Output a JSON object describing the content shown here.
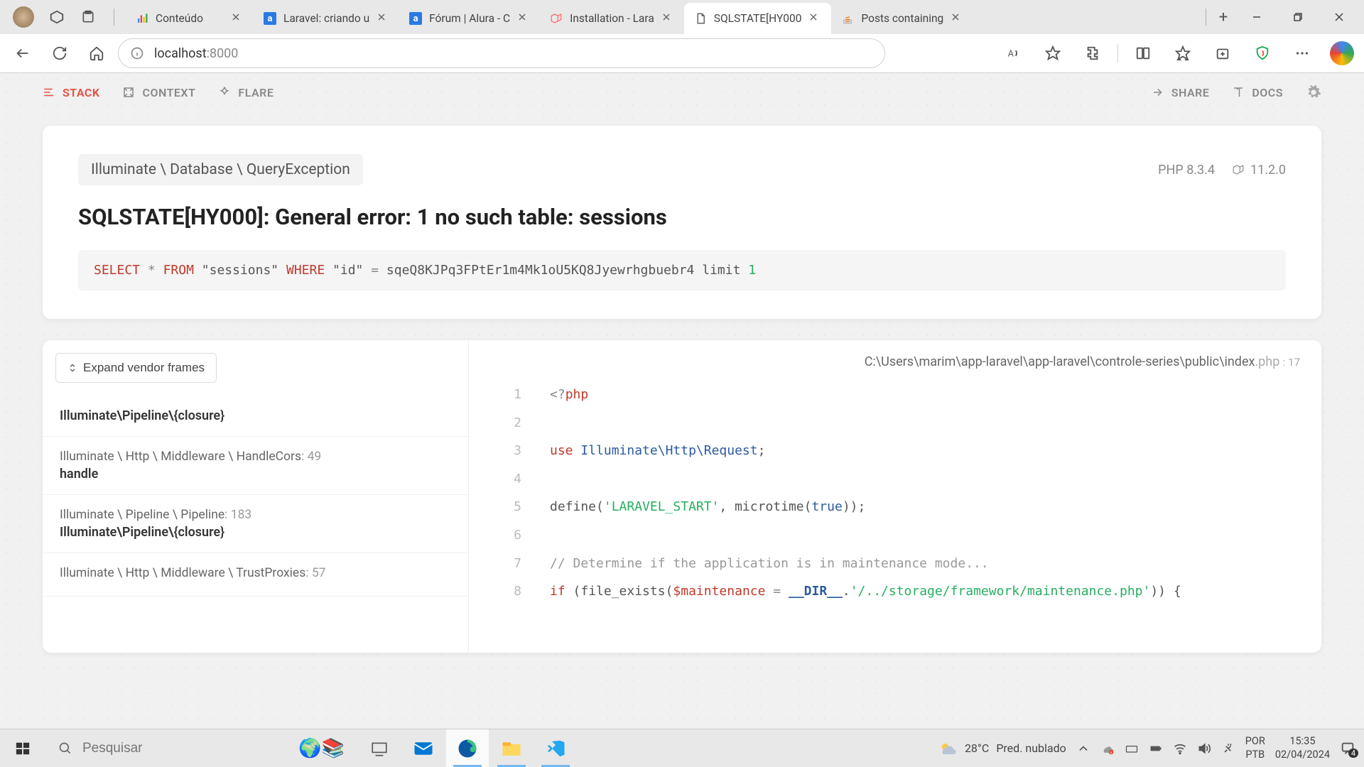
{
  "browser": {
    "tabs": [
      {
        "title": "Conteúdo",
        "favicon": "bars"
      },
      {
        "title": "Laravel: criando u",
        "favicon": "alura-a"
      },
      {
        "title": "Fórum | Alura - C",
        "favicon": "alura-a"
      },
      {
        "title": "Installation - Lara",
        "favicon": "laravel"
      },
      {
        "title": "SQLSTATE[HY000",
        "favicon": "doc",
        "active": true
      },
      {
        "title": "Posts containing",
        "favicon": "so"
      }
    ],
    "url_host": "localhost",
    "url_port": ":8000"
  },
  "ignition": {
    "nav": {
      "stack": "STACK",
      "context": "CONTEXT",
      "flare": "FLARE",
      "share": "SHARE",
      "docs": "DOCS"
    },
    "exception": "Illuminate \\ Database \\ QueryException",
    "php_ver": "PHP 8.3.4",
    "laravel_ver": "11.2.0",
    "title": "SQLSTATE[HY000]: General error: 1 no such table: sessions",
    "sql": {
      "select": "SELECT",
      "star": "*",
      "from": "FROM",
      "table": "\"sessions\"",
      "where": "WHERE",
      "col": "\"id\"",
      "eq": "=",
      "val": "sqeQ8KJPq3FPtEr1m4Mk1oU5KQ8Jyewrhgbuebr4",
      "limit": "limit",
      "one": "1"
    },
    "expand_label": "Expand vendor frames",
    "frames": [
      {
        "path": "",
        "method": "Illuminate\\Pipeline\\{closure}"
      },
      {
        "path": "Illuminate \\ Http \\ Middleware \\ HandleCors",
        "line": ": 49",
        "method": "handle"
      },
      {
        "path": "Illuminate \\ Pipeline \\ Pipeline",
        "line": ": 183",
        "method": "Illuminate\\Pipeline\\{closure}"
      },
      {
        "path": "Illuminate \\ Http \\ Middleware \\ TrustProxies",
        "line": ": 57",
        "method": ""
      }
    ],
    "file_path": "C:\\Users\\marim\\app-laravel\\app-laravel\\controle-series\\public\\index",
    "file_ext": ".php",
    "file_line": ": 17",
    "code": [
      {
        "n": "1",
        "html": "<span class='tok-op'>&lt;?</span><span class='tok-kw'>php</span>"
      },
      {
        "n": "2",
        "html": ""
      },
      {
        "n": "3",
        "html": "<span class='tok-kw'>use</span> <span class='tok-ns'>Illuminate\\Http\\Request</span>;"
      },
      {
        "n": "4",
        "html": ""
      },
      {
        "n": "5",
        "html": "define(<span class='tok-str'>'LARAVEL_START'</span>, microtime(<span class='tok-ns'>true</span>));"
      },
      {
        "n": "6",
        "html": ""
      },
      {
        "n": "7",
        "html": "<span class='tok-cmt'>// Determine if the application is in maintenance mode...</span>"
      },
      {
        "n": "8",
        "html": "<span class='tok-kw'>if</span> (file_exists(<span class='tok-var'>$maintenance</span> <span class='tok-op'>=</span> <span class='tok-const'>__DIR__</span>.<span class='tok-str'>'/../storage/framework/maintenance.php'</span>)) {"
      }
    ]
  },
  "taskbar": {
    "search_placeholder": "Pesquisar",
    "weather_temp": "28°C",
    "weather_desc": "Pred. nublado",
    "lang1": "POR",
    "lang2": "PTB",
    "time": "15:35",
    "date": "02/04/2024",
    "notif": "4"
  }
}
